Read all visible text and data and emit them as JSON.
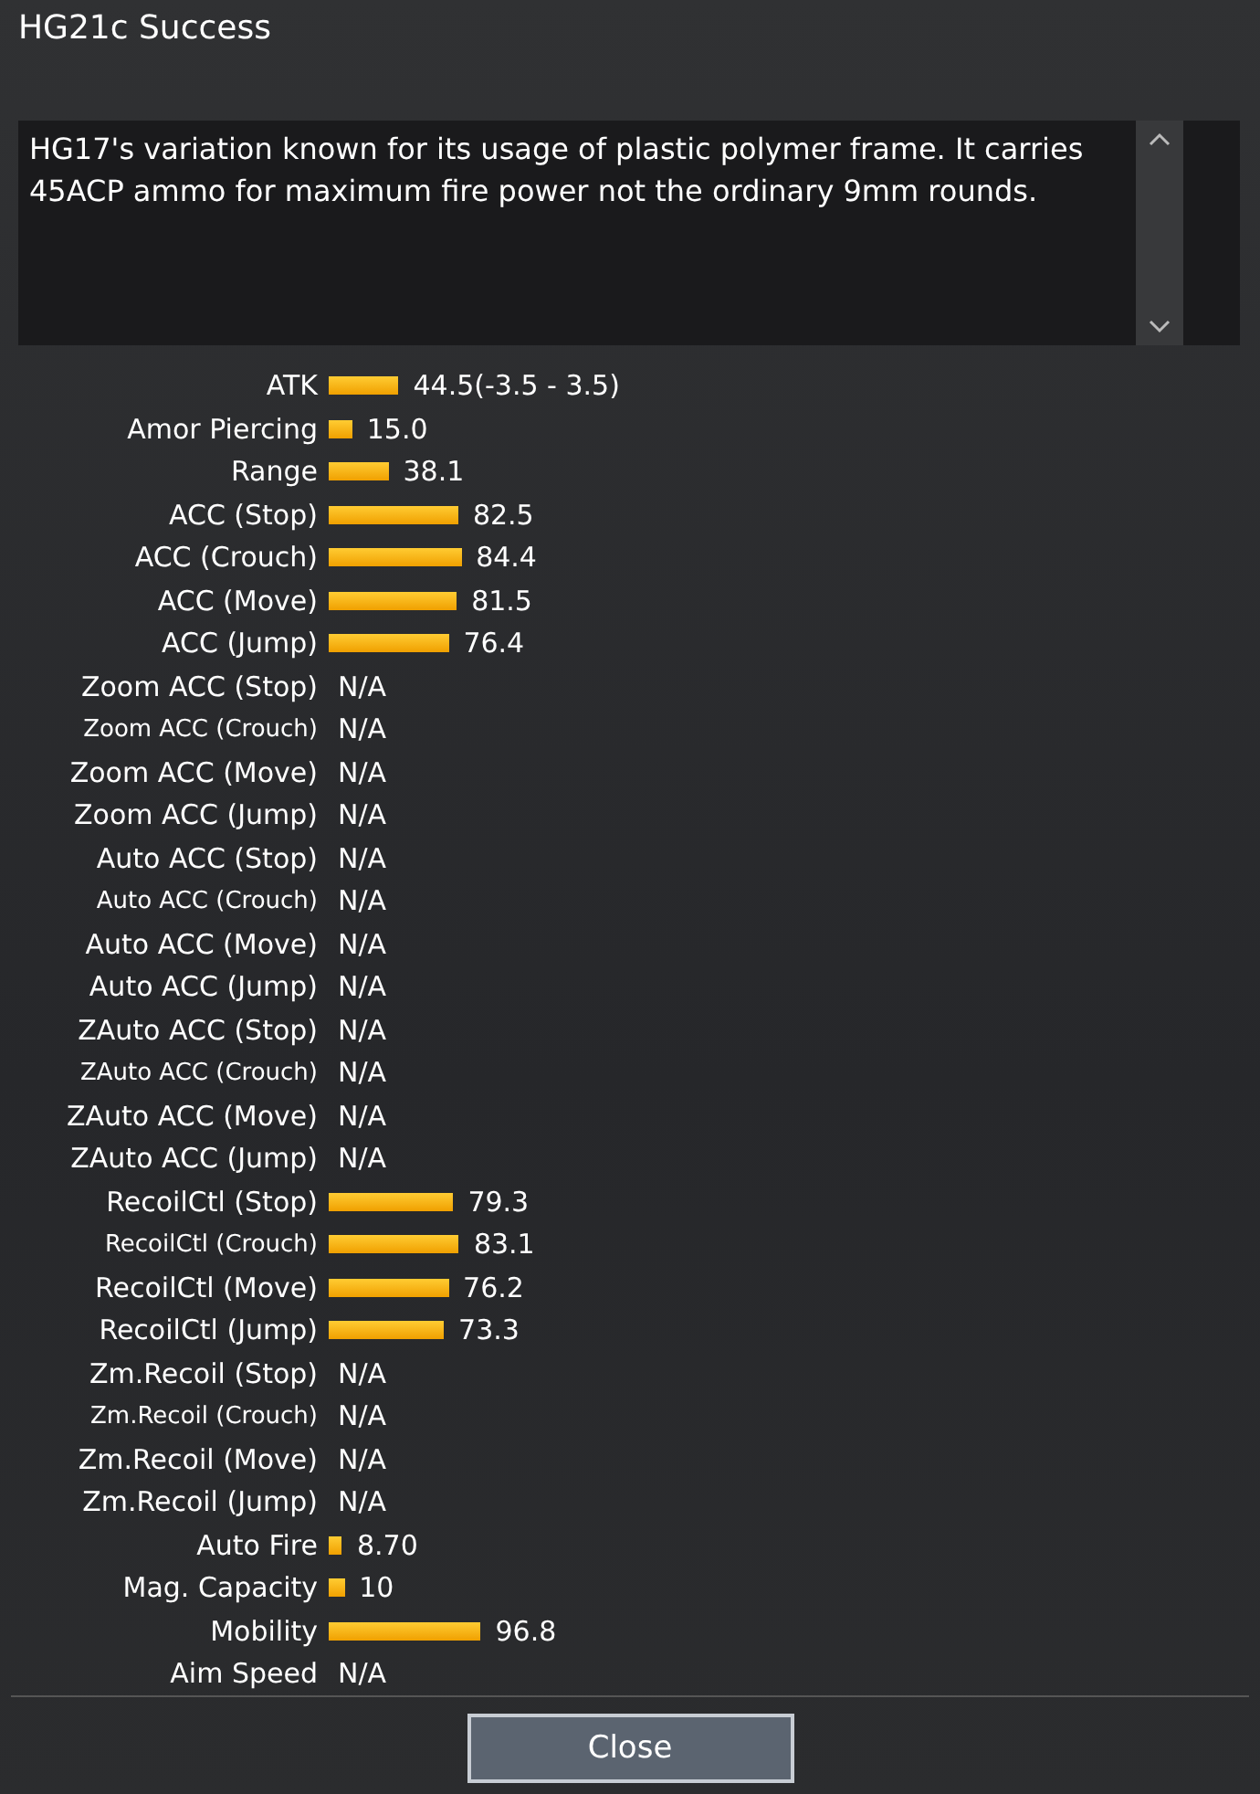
{
  "window": {
    "title": "HG21c Success"
  },
  "description": "HG17's variation known for its usage of plastic polymer frame. It carries 45ACP ammo for maximum fire power not the ordinary 9mm rounds.",
  "stats": [
    {
      "label": "ATK",
      "kind": "bar",
      "value": "44.5(-3.5 - 3.5)"
    },
    {
      "label": "Amor Piercing",
      "kind": "bar",
      "value": "15.0"
    },
    {
      "label": "Range",
      "kind": "bar",
      "value": "38.1"
    },
    {
      "label": "ACC (Stop)",
      "kind": "bar",
      "value": "82.5"
    },
    {
      "label": "ACC (Crouch)",
      "kind": "bar",
      "value": "84.4"
    },
    {
      "label": "ACC (Move)",
      "kind": "bar",
      "value": "81.5"
    },
    {
      "label": "ACC (Jump)",
      "kind": "bar",
      "value": "76.4"
    },
    {
      "label": "Zoom ACC (Stop)",
      "kind": "text",
      "value": "N/A"
    },
    {
      "label": "Zoom ACC (Crouch)",
      "kind": "text",
      "value": "N/A"
    },
    {
      "label": "Zoom ACC (Move)",
      "kind": "text",
      "value": "N/A"
    },
    {
      "label": "Zoom ACC (Jump)",
      "kind": "text",
      "value": "N/A"
    },
    {
      "label": "Auto ACC (Stop)",
      "kind": "text",
      "value": "N/A"
    },
    {
      "label": "Auto ACC (Crouch)",
      "kind": "text",
      "value": "N/A"
    },
    {
      "label": "Auto ACC (Move)",
      "kind": "text",
      "value": "N/A"
    },
    {
      "label": "Auto ACC (Jump)",
      "kind": "text",
      "value": "N/A"
    },
    {
      "label": "ZAuto ACC (Stop)",
      "kind": "text",
      "value": "N/A"
    },
    {
      "label": "ZAuto ACC (Crouch)",
      "kind": "text",
      "value": "N/A"
    },
    {
      "label": "ZAuto ACC (Move)",
      "kind": "text",
      "value": "N/A"
    },
    {
      "label": "ZAuto ACC (Jump)",
      "kind": "text",
      "value": "N/A"
    },
    {
      "label": "RecoilCtl (Stop)",
      "kind": "bar",
      "value": "79.3"
    },
    {
      "label": "RecoilCtl (Crouch)",
      "kind": "bar",
      "value": "83.1"
    },
    {
      "label": "RecoilCtl (Move)",
      "kind": "bar",
      "value": "76.2"
    },
    {
      "label": "RecoilCtl (Jump)",
      "kind": "bar",
      "value": "73.3"
    },
    {
      "label": "Zm.Recoil (Stop)",
      "kind": "text",
      "value": "N/A"
    },
    {
      "label": "Zm.Recoil (Crouch)",
      "kind": "text",
      "value": "N/A"
    },
    {
      "label": "Zm.Recoil (Move)",
      "kind": "text",
      "value": "N/A"
    },
    {
      "label": "Zm.Recoil (Jump)",
      "kind": "text",
      "value": "N/A"
    },
    {
      "label": "Auto Fire",
      "kind": "bar",
      "value": "8.70"
    },
    {
      "label": "Mag. Capacity",
      "kind": "bar",
      "value": "10"
    },
    {
      "label": "Mobility",
      "kind": "bar",
      "value": "96.8"
    },
    {
      "label": "Aim Speed",
      "kind": "text",
      "value": "N/A"
    }
  ],
  "close_button": "Close"
}
